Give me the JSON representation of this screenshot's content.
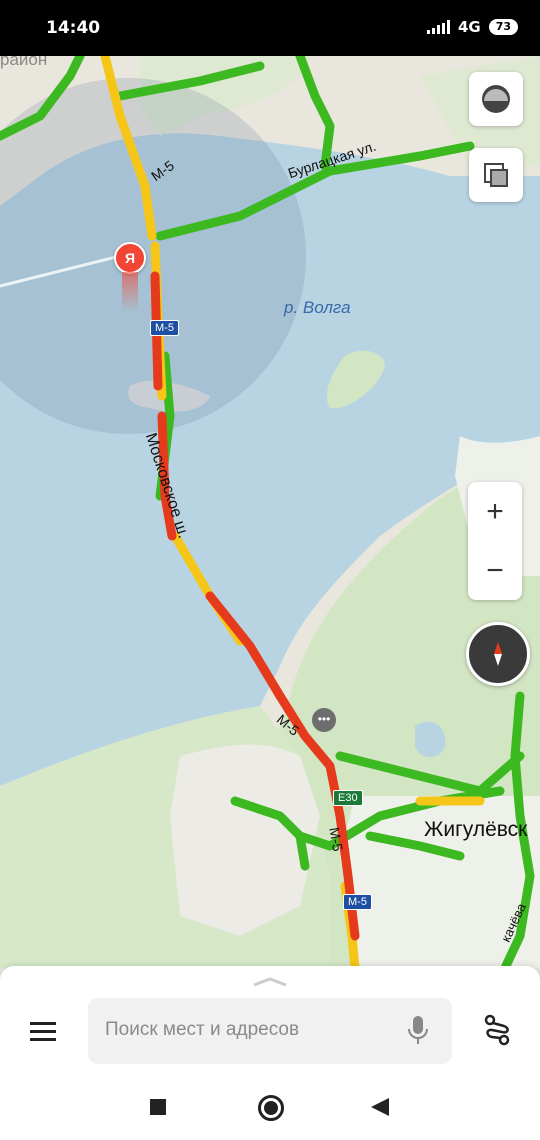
{
  "status_bar": {
    "time": "14:40",
    "network": "4G",
    "battery": "73"
  },
  "map": {
    "labels": {
      "district": "район",
      "river": "р. Волга",
      "street_burlatskaya": "Бурлацкая ул.",
      "highway": "Московское ш.",
      "road_m5": "M-5",
      "city": "Жигулёвск",
      "street_partial": "качёва"
    },
    "shields": {
      "m5": "M-5",
      "e30": "E30"
    },
    "user_marker": "Я"
  },
  "controls": {
    "zoom_in": "+",
    "zoom_out": "−"
  },
  "bottom_sheet": {
    "search_placeholder": "Поиск мест и адресов"
  },
  "colors": {
    "water": "#b8d4e3",
    "land": "#e9e6dd",
    "forest": "#d3e6c4",
    "traffic_green": "#3cb820",
    "traffic_yellow": "#f5c518",
    "traffic_red": "#e53b1c",
    "marker": "#f24533"
  }
}
